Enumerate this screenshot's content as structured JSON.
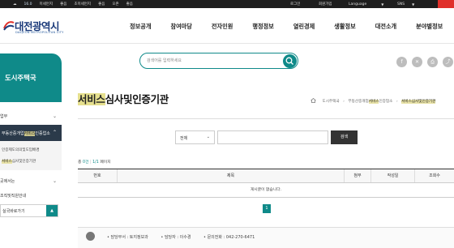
{
  "topbar": {
    "weather_temp": "16.0",
    "items": [
      "미세먼지",
      "좋음",
      "초미세먼지",
      "좋음",
      "오존",
      "좋음"
    ],
    "login": "로그인",
    "join": "회원가입",
    "language": "Language",
    "sns": "SNS"
  },
  "logo": {
    "korean": "대전광역시",
    "english": "DAEJEON METROPOLITAN CITY"
  },
  "gnb": [
    "정보공개",
    "참여마당",
    "전자민원",
    "행정정보",
    "열린경제",
    "생활정보",
    "대전소개",
    "분야별정보"
  ],
  "sidebar": {
    "title": "도시주택국",
    "items": [
      {
        "label": "업무"
      },
      {
        "label": "부동산중개업",
        "hl": "서비스",
        "rest": "인증업소",
        "active": true
      },
      {
        "label": "인증제도의의및도입배경"
      },
      {
        "label": "서비스심사및인증기관",
        "hl_prefix": "서비스"
      },
      {
        "label": "곳에서는"
      },
      {
        "label": "조직및직원안내"
      }
    ],
    "select_label": "실국바로가기",
    "select_button": "이동"
  },
  "search": {
    "placeholder": "검색어를 입력하세요"
  },
  "share_icons": [
    "facebook-icon",
    "x-icon",
    "print-icon",
    "share-icon"
  ],
  "page": {
    "title_hl": "서비스",
    "title_rest": "심사및인증기관",
    "breadcrumb": [
      "도시주택국",
      "부동산중개업",
      "서비스심사및인증기관"
    ],
    "breadcrumb_mid_hl": "서비스",
    "breadcrumb_mid_tail": "인증업소"
  },
  "filter": {
    "select_value": "전체",
    "button": "검색"
  },
  "count": {
    "prefix": "총",
    "total": "0건",
    "page": "1/1",
    "page_suffix": "페이지"
  },
  "table": {
    "headers": [
      "번호",
      "제목",
      "첨부",
      "작성일",
      "조회수"
    ],
    "empty": "게시글이 없습니다."
  },
  "pagination": {
    "current": "1"
  },
  "manager": {
    "dept_label": "담당부서 : 토지정보과",
    "person_label": "담당자 : 이수경",
    "phone_label": "문의전화 : 042-270-6471"
  },
  "colors": {
    "accent": "#0f8a89",
    "highlight": "#e6e08e",
    "topbar": "#1e1e1e",
    "sns": "#e0302a"
  }
}
